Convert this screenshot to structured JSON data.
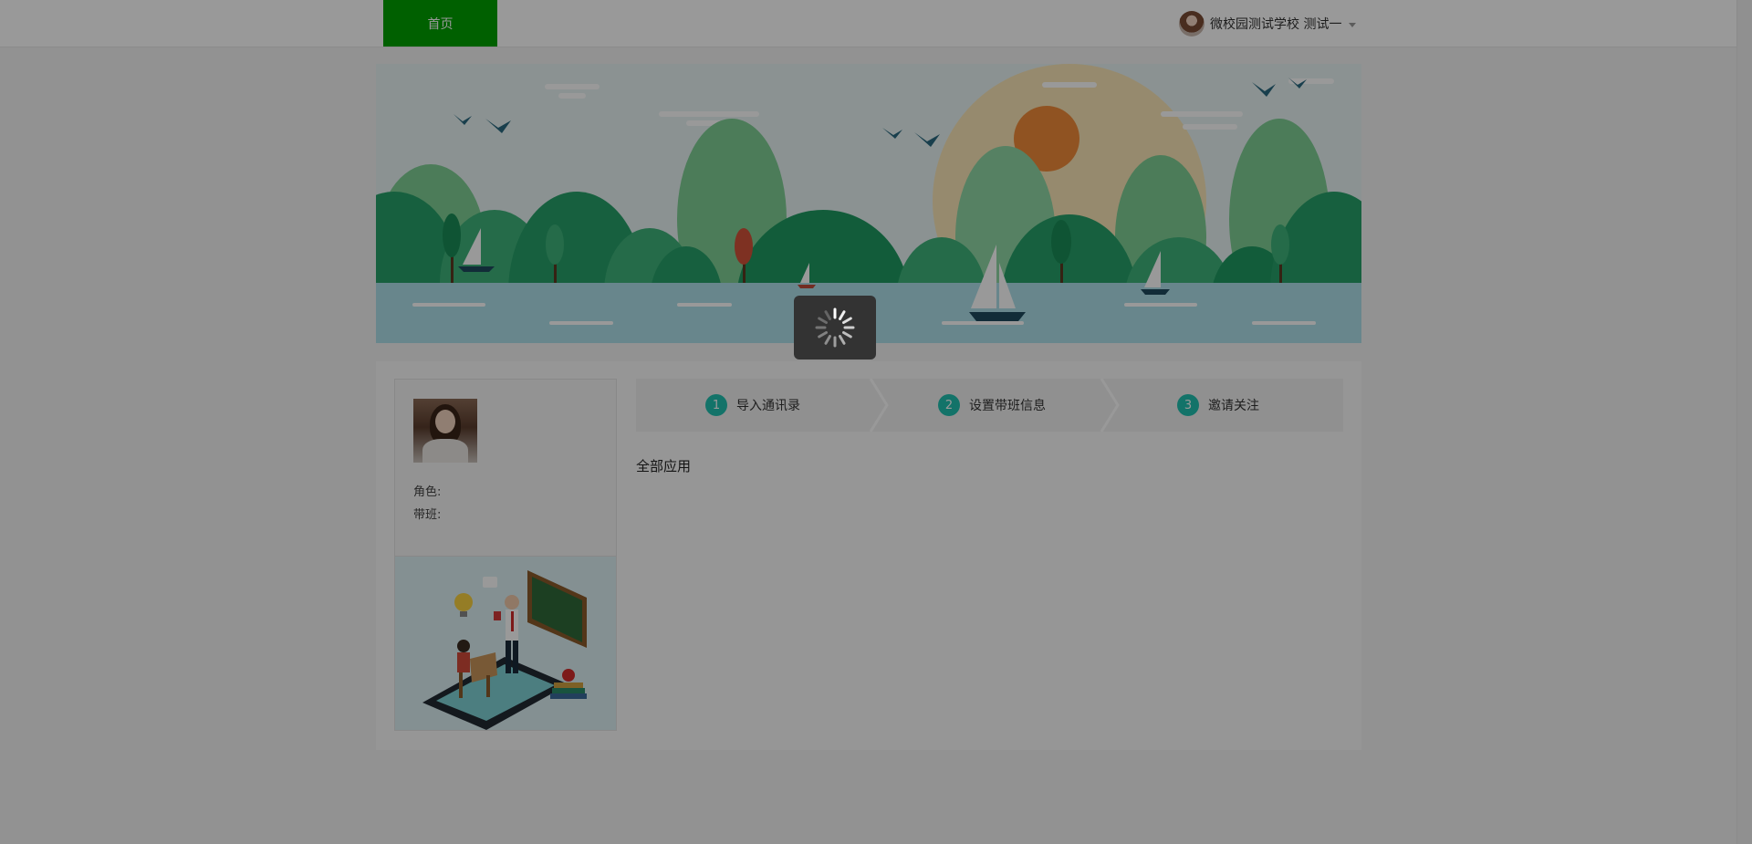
{
  "nav": {
    "home_label": "首页",
    "user_name": "微校园测试学校 测试一"
  },
  "profile": {
    "role_label": "角色:",
    "class_label": "带班:"
  },
  "steps": [
    {
      "number": "1",
      "label": "导入通讯录"
    },
    {
      "number": "2",
      "label": "设置带班信息"
    },
    {
      "number": "3",
      "label": "邀请关注"
    }
  ],
  "section": {
    "title": "全部应用"
  },
  "colors": {
    "nav_active": "#00a000",
    "step_badge": "#20c0b0"
  },
  "icons": {
    "loading": "spinner-icon",
    "user_menu": "chevron-down-icon"
  }
}
